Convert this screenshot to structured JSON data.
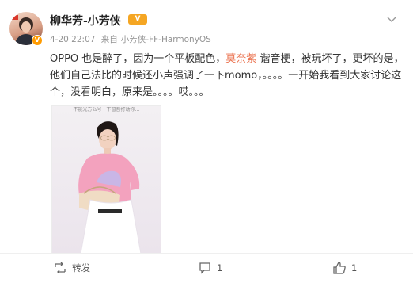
{
  "post": {
    "author": "柳华芳-小芳侠",
    "level_badge": "V",
    "verified_badge": "V",
    "time": "4-20 22:07",
    "source_prefix": "来自",
    "source": "小芳侠-FF-HarmonyOS",
    "content": {
      "part1": "OPPO 也是醉了，因为一个平板配色，",
      "highlight": "莫奈紫",
      "part2": "谐音梗，被玩坏了，更坏的是，他们自己法比的时候还小声强调了一下momo，。。。。一开始我看到大家讨论这个，没看明白，原来是。。。。哎。。。"
    },
    "image_caption": "不能光方么号一下窗音打动你…"
  },
  "actions": {
    "repost_label": "转发",
    "comment_count": "1",
    "like_count": "1"
  },
  "icons": [
    "avatar",
    "verified-icon",
    "chevron-down-icon",
    "repost-icon",
    "comment-icon",
    "like-icon"
  ],
  "colors": {
    "highlight": "#eb7350",
    "meta": "#939393",
    "level_badge": "#f5a623"
  }
}
